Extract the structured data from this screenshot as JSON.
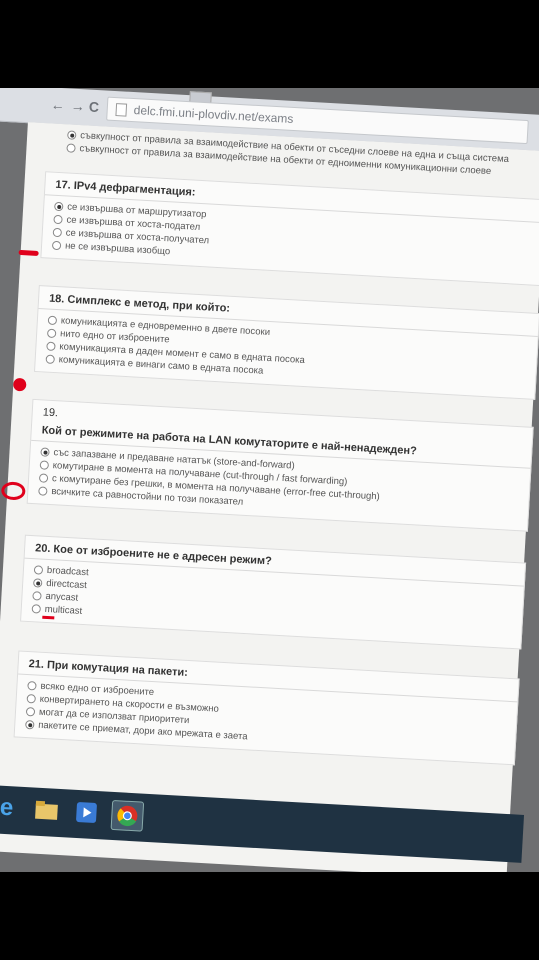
{
  "browser": {
    "back": "←",
    "forward": "→",
    "reload": "C",
    "url": "delc.fmi.uni-plovdiv.net/exams"
  },
  "top_options": [
    "съвкупност от правила за взаимодействие на обекти от съседни слоеве на една и съща система",
    "съвкупност от правила за взаимодействие на обекти от едноименни комуникационни слоеве"
  ],
  "questions": [
    {
      "title": "17. IPv4 дефрагментация:",
      "options": [
        "се извършва от маршрутизатор",
        "се извършва от хоста-подател",
        "се извършва от хоста-получател",
        "не се извършва изобщо"
      ],
      "selected_index": 0
    },
    {
      "title": "18. Симплекс е метод, при който:",
      "options": [
        "комуникацията е едновременно в двете посоки",
        "нито едно от изброените",
        "комуникацията в даден момент е само в едната посока",
        "комуникацията е винаги само в едната посока"
      ],
      "selected_index": -1
    },
    {
      "number": "19.",
      "title": "Кой от режимите на работа на LAN комутаторите е най-ненадежден?",
      "options": [
        "със запазване и предаване нататък (store-and-forward)",
        "комутиране в момента на получаване (cut-through / fast forwarding)",
        "с комутиране без грешки, в момента на получаване (error-free cut-through)",
        "всичките са равностойни по този показател"
      ],
      "selected_index": 0
    },
    {
      "title": "20. Кое от изброените не е адресен режим?",
      "options": [
        "broadcast",
        "directcast",
        "anycast",
        "multicast"
      ],
      "selected_index": 1
    },
    {
      "title": "21. При комутация на пакети:",
      "options": [
        "всяко едно от изброените",
        "конвертирането на скорости е възможно",
        "могат да се използват приоритети",
        "пакетите се приемат, дори ако мрежата е заета"
      ],
      "selected_index": 3
    }
  ],
  "taskbar": [
    "start-button",
    "internet-explorer",
    "file-explorer",
    "media-player",
    "chrome"
  ],
  "colors": {
    "annotation": "#e0001b",
    "taskbar": "#1f3242"
  }
}
